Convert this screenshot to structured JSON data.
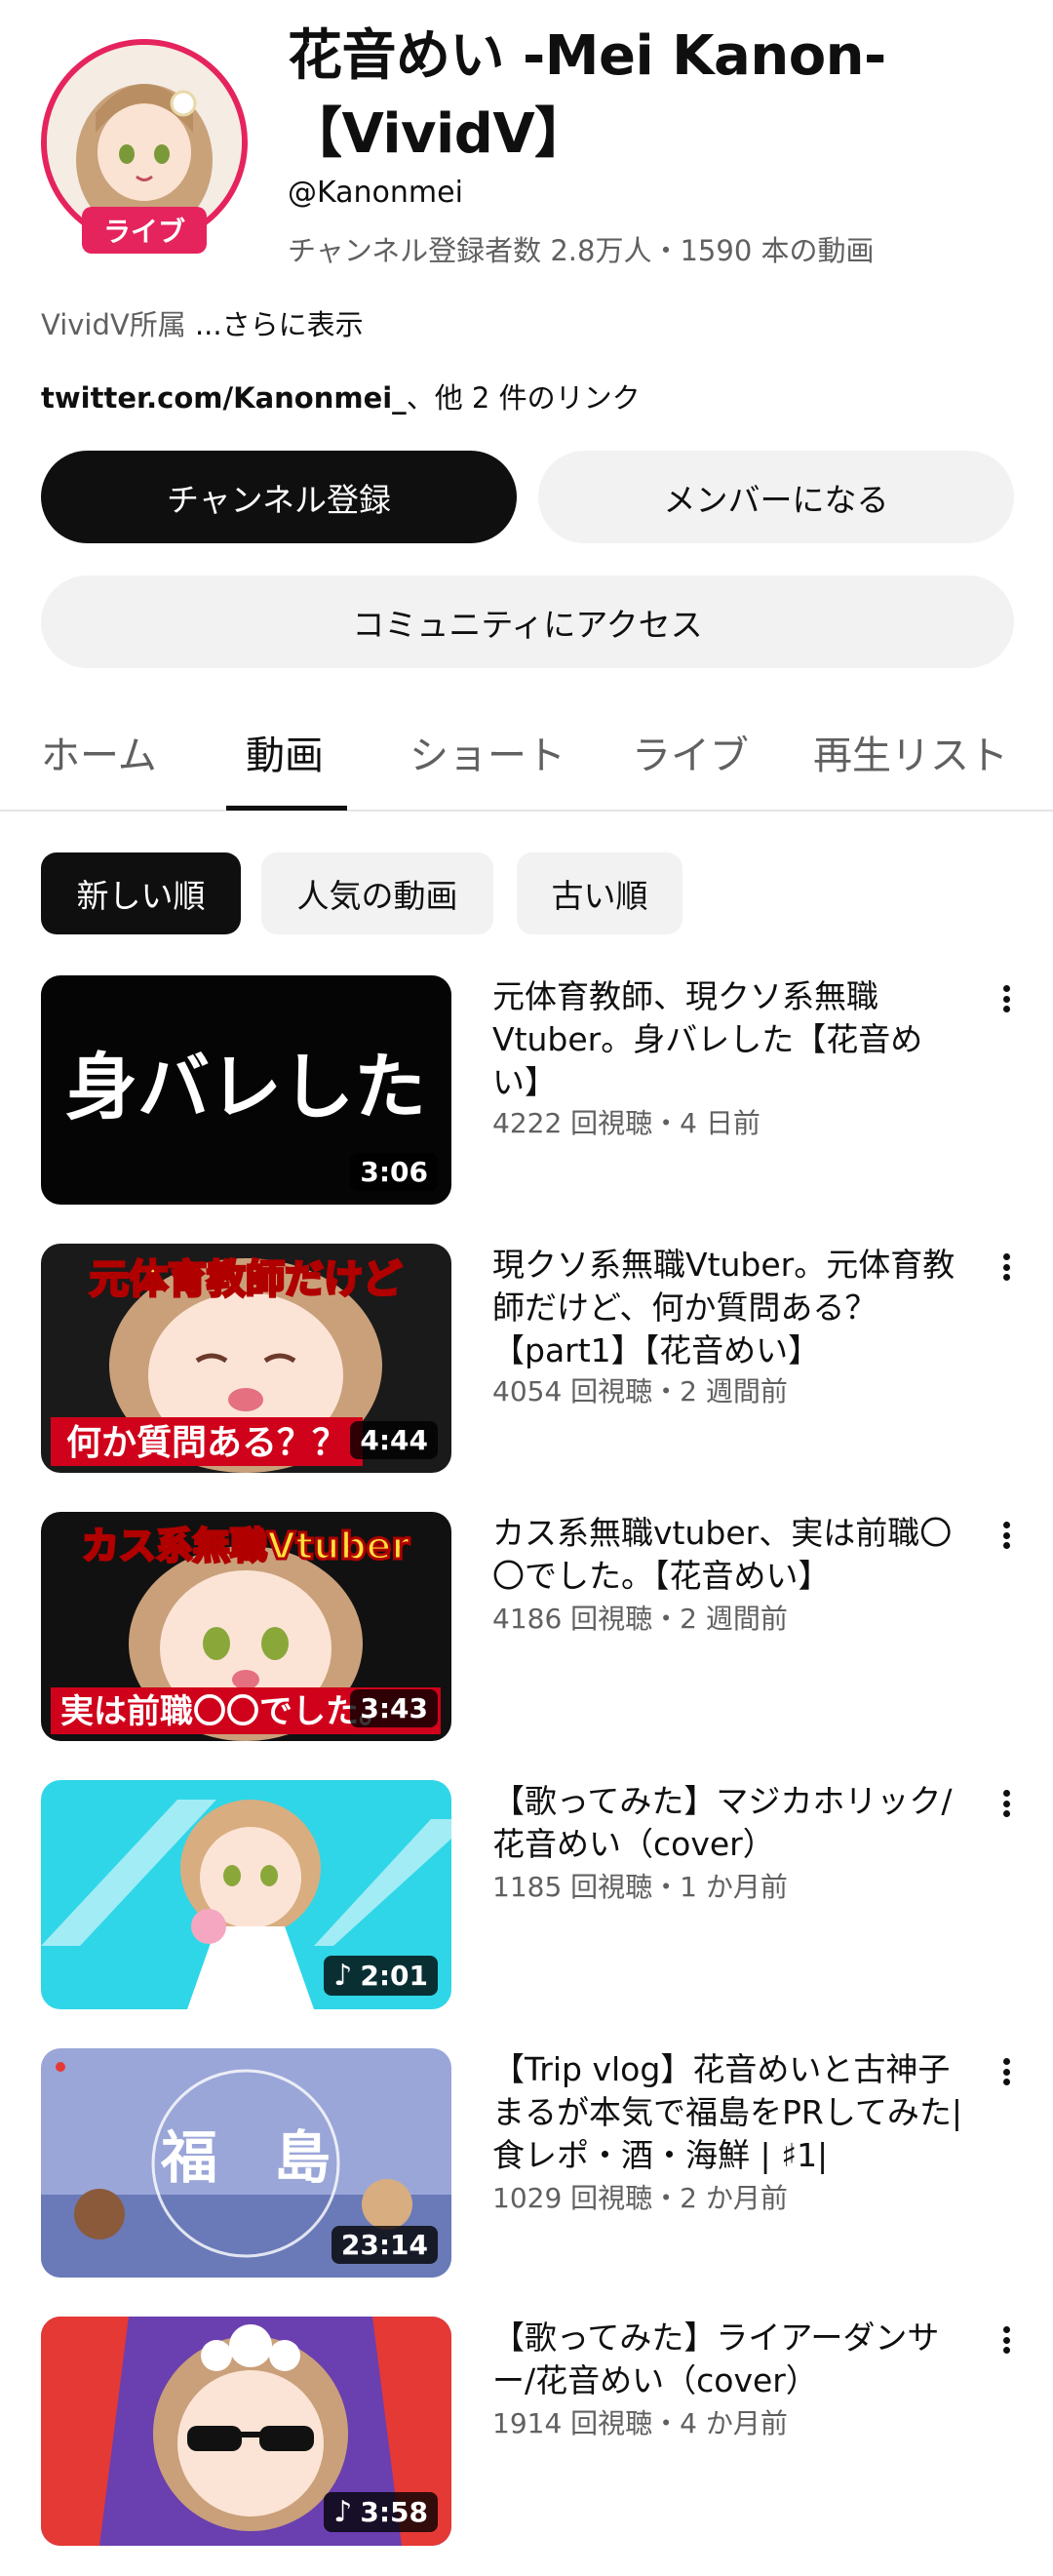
{
  "channel": {
    "title": "花音めい -Mei Kanon-【VividV】",
    "handle": "@Kanonmei",
    "stats": "チャンネル登録者数 2.8万人・1590 本の動画",
    "live_badge": "ライブ",
    "description": "VividV所属",
    "description_more": " ...さらに表示",
    "link_url": "twitter.com/Kanonmei_",
    "link_suffix": "、他 2 件のリンク"
  },
  "buttons": {
    "subscribe": "チャンネル登録",
    "member": "メンバーになる",
    "community": "コミュニティにアクセス"
  },
  "tabs": [
    {
      "label": "ホーム"
    },
    {
      "label": "動画"
    },
    {
      "label": "ショート"
    },
    {
      "label": "ライブ"
    },
    {
      "label": "再生リスト"
    }
  ],
  "chips": {
    "new": "新しい順",
    "popular": "人気の動画",
    "old": "古い順"
  },
  "videos": [
    {
      "title": "元体育教師、現クソ系無職Vtuber。身バレした【花音めい】",
      "meta": "4222 回視聴・4 日前",
      "duration": "3:06",
      "thumb_text": "身バレした"
    },
    {
      "title": "現クソ系無職Vtuber。元体育教師だけど、何か質問ある？【part1】【花音めい】",
      "meta": "4054 回視聴・2 週間前",
      "duration": "4:44",
      "thumb_text_top": "元体育教師だけど",
      "thumb_text_bottom": "何か質問ある？？"
    },
    {
      "title": "カス系無職vtuber、実は前職〇〇でした。【花音めい】",
      "meta": "4186 回視聴・2 週間前",
      "duration": "3:43",
      "thumb_text_top": "カス系無職Vtuber",
      "thumb_text_bottom": "実は前職〇〇でした。"
    },
    {
      "title": "【歌ってみた】マジカホリック/花音めい（cover）",
      "meta": "1185 回視聴・1 か月前",
      "duration": "2:01"
    },
    {
      "title": "【Trip vlog】花音めいと古神子まるが本気で福島をPRしてみた|食レポ・酒・海鮮 | ♯1|",
      "meta": "1029 回視聴・2 か月前",
      "duration": "23:14",
      "thumb_text": "福　島"
    },
    {
      "title": "【歌ってみた】ライアーダンサー/花音めい（cover）",
      "meta": "1914 回視聴・4 か月前",
      "duration": "3:58"
    }
  ],
  "colors": {
    "live_red": "#e5245e",
    "text_primary": "#0f0f0f",
    "text_secondary": "#606060",
    "chip_bg": "#f2f2f2"
  }
}
